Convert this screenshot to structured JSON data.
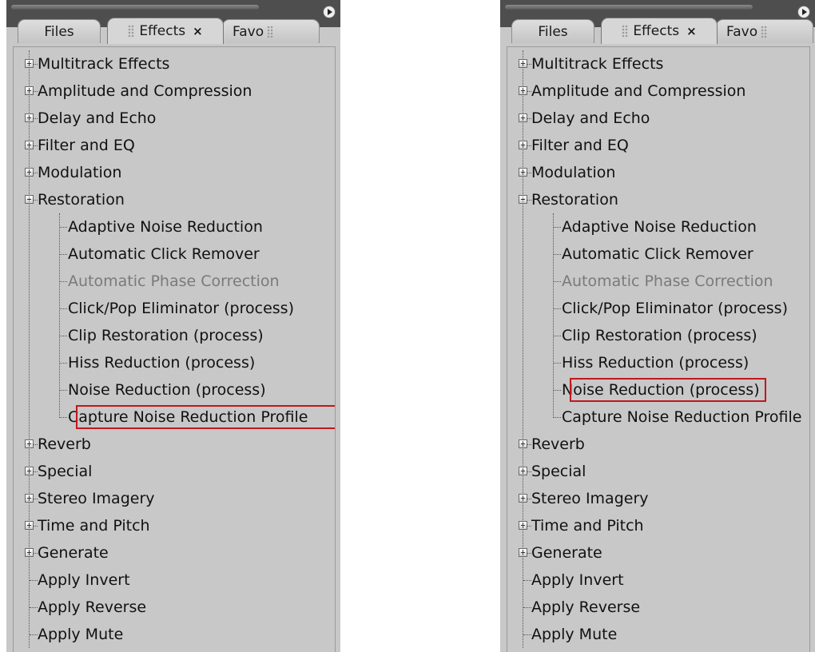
{
  "panels": [
    {
      "tabs": [
        "Files",
        "Effects",
        "Favo"
      ],
      "tab_close": "×",
      "highlight_row": 13,
      "items": [
        {
          "label": "Multitrack Effects",
          "level": 0,
          "expander": "plus"
        },
        {
          "label": "Amplitude and Compression",
          "level": 0,
          "expander": "plus"
        },
        {
          "label": "Delay and Echo",
          "level": 0,
          "expander": "plus"
        },
        {
          "label": "Filter and EQ",
          "level": 0,
          "expander": "plus"
        },
        {
          "label": "Modulation",
          "level": 0,
          "expander": "plus"
        },
        {
          "label": "Restoration",
          "level": 0,
          "expander": "minus"
        },
        {
          "label": "Adaptive Noise Reduction",
          "level": 1
        },
        {
          "label": "Automatic Click Remover",
          "level": 1
        },
        {
          "label": "Automatic Phase Correction",
          "level": 1,
          "disabled": true
        },
        {
          "label": "Click/Pop Eliminator (process)",
          "level": 1
        },
        {
          "label": "Clip Restoration (process)",
          "level": 1
        },
        {
          "label": "Hiss Reduction (process)",
          "level": 1
        },
        {
          "label": "Noise Reduction (process)",
          "level": 1
        },
        {
          "label": "Capture Noise Reduction Profile",
          "level": 1
        },
        {
          "label": "Reverb",
          "level": 0,
          "expander": "plus"
        },
        {
          "label": "Special",
          "level": 0,
          "expander": "plus"
        },
        {
          "label": "Stereo Imagery",
          "level": 0,
          "expander": "plus"
        },
        {
          "label": "Time and Pitch",
          "level": 0,
          "expander": "plus"
        },
        {
          "label": "Generate",
          "level": 0,
          "expander": "plus"
        },
        {
          "label": "Apply Invert",
          "level": 0
        },
        {
          "label": "Apply Reverse",
          "level": 0
        },
        {
          "label": "Apply Mute",
          "level": 0
        }
      ]
    },
    {
      "tabs": [
        "Files",
        "Effects",
        "Favo"
      ],
      "tab_close": "×",
      "highlight_row": 12,
      "items": [
        {
          "label": "Multitrack Effects",
          "level": 0,
          "expander": "plus"
        },
        {
          "label": "Amplitude and Compression",
          "level": 0,
          "expander": "plus"
        },
        {
          "label": "Delay and Echo",
          "level": 0,
          "expander": "plus"
        },
        {
          "label": "Filter and EQ",
          "level": 0,
          "expander": "plus"
        },
        {
          "label": "Modulation",
          "level": 0,
          "expander": "plus"
        },
        {
          "label": "Restoration",
          "level": 0,
          "expander": "minus"
        },
        {
          "label": "Adaptive Noise Reduction",
          "level": 1
        },
        {
          "label": "Automatic Click Remover",
          "level": 1
        },
        {
          "label": "Automatic Phase Correction",
          "level": 1,
          "disabled": true
        },
        {
          "label": "Click/Pop Eliminator (process)",
          "level": 1
        },
        {
          "label": "Clip Restoration (process)",
          "level": 1
        },
        {
          "label": "Hiss Reduction (process)",
          "level": 1
        },
        {
          "label": "Noise Reduction (process)",
          "level": 1
        },
        {
          "label": "Capture Noise Reduction Profile",
          "level": 1
        },
        {
          "label": "Reverb",
          "level": 0,
          "expander": "plus"
        },
        {
          "label": "Special",
          "level": 0,
          "expander": "plus"
        },
        {
          "label": "Stereo Imagery",
          "level": 0,
          "expander": "plus"
        },
        {
          "label": "Time and Pitch",
          "level": 0,
          "expander": "plus"
        },
        {
          "label": "Generate",
          "level": 0,
          "expander": "plus"
        },
        {
          "label": "Apply Invert",
          "level": 0
        },
        {
          "label": "Apply Reverse",
          "level": 0
        },
        {
          "label": "Apply Mute",
          "level": 0
        }
      ]
    }
  ],
  "colors": {
    "panel_bg": "#c8c8c8",
    "highlight": "#c0181f",
    "disabled_text": "#7a7a7a"
  }
}
